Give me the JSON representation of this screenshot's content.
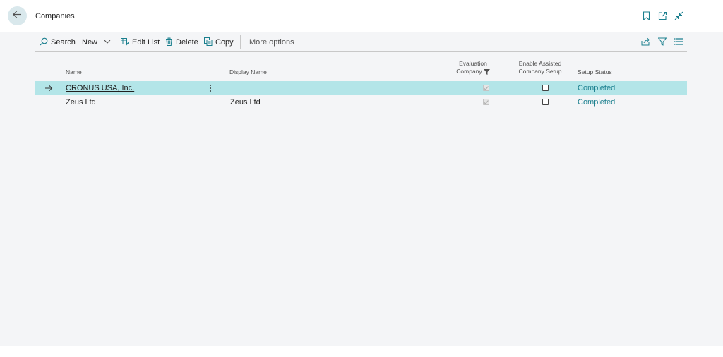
{
  "page": {
    "title": "Companies"
  },
  "colors": {
    "accent": "#1a7f8e",
    "selected_row": "#b3e5e8",
    "background": "#f4f5f7"
  },
  "toolbar": {
    "search_label": "Search",
    "new_label": "New",
    "edit_list_label": "Edit List",
    "delete_label": "Delete",
    "copy_label": "Copy",
    "more_options_label": "More options"
  },
  "table": {
    "columns": {
      "name": "Name",
      "display_name": "Display Name",
      "evaluation_line1": "Evaluation",
      "evaluation_line2": "Company",
      "assisted_line1": "Enable Assisted",
      "assisted_line2": "Company Setup",
      "setup_status": "Setup Status"
    },
    "rows": [
      {
        "name": "CRONUS USA, Inc.",
        "display_name": "",
        "evaluation_company": true,
        "enable_assisted_setup": false,
        "setup_status": "Completed",
        "selected": true
      },
      {
        "name": "Zeus Ltd",
        "display_name": "Zeus Ltd",
        "evaluation_company": true,
        "enable_assisted_setup": false,
        "setup_status": "Completed",
        "selected": false
      }
    ]
  },
  "icons": {
    "back": "arrow-left-icon",
    "bookmark": "bookmark-icon",
    "open_new_window": "open-new-window-icon",
    "collapse": "collapse-icon",
    "search": "search-icon",
    "edit_list": "edit-list-icon",
    "delete": "trash-icon",
    "copy": "copy-icon",
    "share": "share-icon",
    "filter": "filter-icon",
    "list_view": "list-view-icon"
  }
}
